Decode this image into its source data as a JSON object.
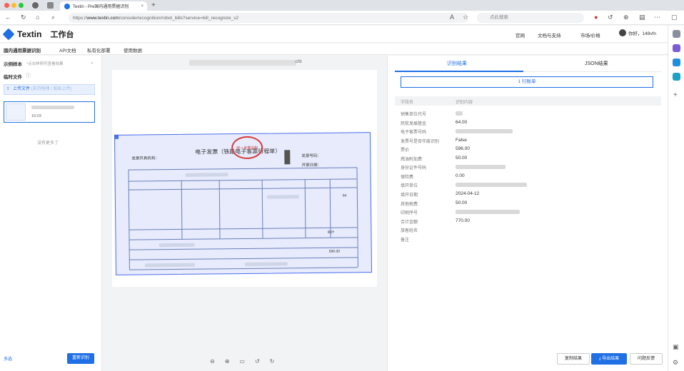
{
  "browser": {
    "tab_title": "Textin - Pre国内通用票据识别",
    "url_prefix": "https://",
    "url_host": "www.textin.com",
    "url_path": "/console/recognition/robot_bills?service=bill_recognize_v2",
    "search_placeholder": "点此搜索",
    "new_tab": "+",
    "close_tab": "×"
  },
  "header": {
    "logo": "Textin",
    "workspace": "工作台",
    "links": [
      "官网",
      "文档与支持",
      "市场/价格"
    ],
    "user": "你好，148vfn"
  },
  "subnav": [
    "国内通用票据识别",
    "API文档",
    "私有化部署",
    "使用数据"
  ],
  "left": {
    "sample_label": "示例样本",
    "sample_hint": "*点击样例可查看效果",
    "temp_label": "临时文件",
    "upload_label": "上传文件",
    "upload_hint": "(支持拖拽 / 粘贴上传)",
    "thumb_time": "16:03",
    "no_more": "没有更多了",
    "footer_link": "多选",
    "reidentify_button": "重新识别"
  },
  "center": {
    "file_ext": ".cfd",
    "invoice": {
      "title": "电子发票（铁路电子客票行程单）",
      "issuer_label": "发票开具机构：",
      "stamp": "统一发票监制",
      "number_label": "发票号码：",
      "date_label": "开票日期：",
      "amount": "64",
      "total_label": "合计",
      "price": "596.00"
    }
  },
  "right": {
    "tabs": [
      "识别结果",
      "JSON结果"
    ],
    "count": "1 行账单",
    "col_field": "字段名",
    "col_value": "识别内容",
    "rows": [
      {
        "k": "销售单位代号",
        "v": ""
      },
      {
        "k": "民航发展基金",
        "v": "64.00"
      },
      {
        "k": "电子客票号码",
        "v": ""
      },
      {
        "k": "发票号是否作废识别",
        "v": "False"
      },
      {
        "k": "票价",
        "v": "596.00"
      },
      {
        "k": "燃油附加费",
        "v": "50.00"
      },
      {
        "k": "身份证件号码",
        "v": ""
      },
      {
        "k": "保险费",
        "v": "0.00"
      },
      {
        "k": "填开单位",
        "v": ""
      },
      {
        "k": "填开日期",
        "v": "2024-04-12"
      },
      {
        "k": "其他税费",
        "v": "50.00"
      },
      {
        "k": "印刷序号",
        "v": ""
      },
      {
        "k": "合计金额",
        "v": "770.00"
      },
      {
        "k": "旅客姓名",
        "v": ""
      },
      {
        "k": "备注",
        "v": ""
      }
    ],
    "buttons": {
      "copy": "复制结果",
      "export": "导出结果",
      "feedback": "问题反馈"
    }
  }
}
